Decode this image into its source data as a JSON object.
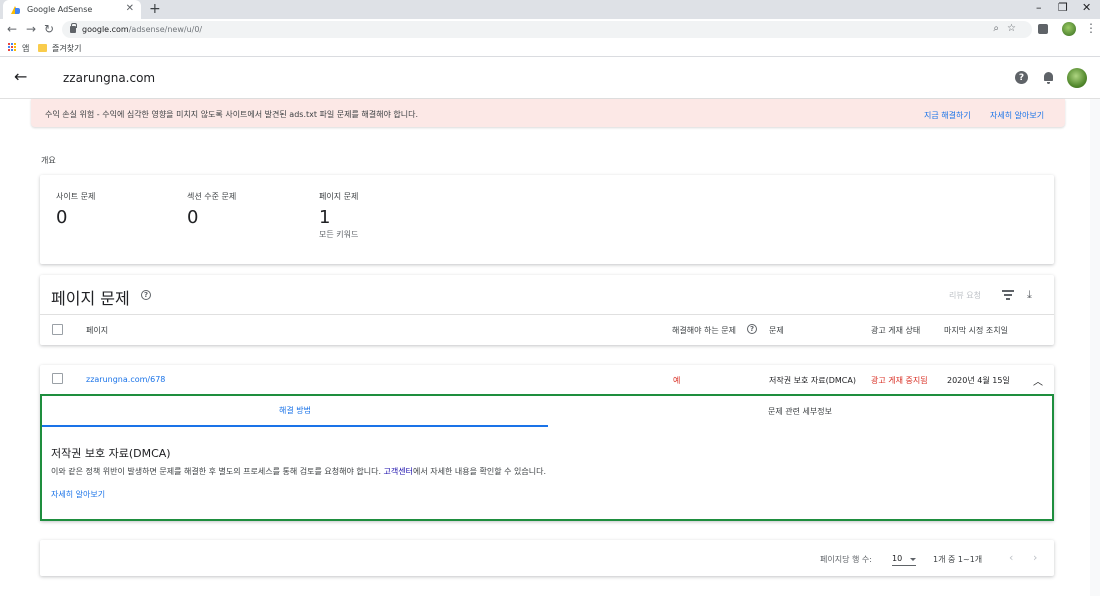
{
  "browser": {
    "tab_title": "Google AdSense",
    "tab_close": "✕",
    "new_tab": "+",
    "url_host": "google.com",
    "url_path": "/adsense/new/u/0/",
    "bookmarks": [
      {
        "label": "앱"
      },
      {
        "label": "즐겨찾기"
      }
    ],
    "window_controls": [
      "–",
      "❐",
      "✕"
    ]
  },
  "appbar": {
    "back": "←",
    "site": "zzarungna.com",
    "help": "?"
  },
  "alert": {
    "message": "수익 손실 위험 - 수익에 심각한 영향을 미치지 않도록 사이트에서 발견된 ads.txt 파일 문제를 해결해야 합니다.",
    "fix_now": "지금 해결하기",
    "learn_more": "자세히 알아보기",
    "color": "#fce8e6"
  },
  "overview": {
    "label": "개요",
    "stats": [
      {
        "label": "사이트 문제",
        "value": "0",
        "sub": ""
      },
      {
        "label": "섹션 수준 문제",
        "value": "0",
        "sub": ""
      },
      {
        "label": "페이지 문제",
        "value": "1",
        "sub": "모든 키워드"
      }
    ]
  },
  "issues": {
    "title": "페이지 문제",
    "review_request": "리뷰 요청",
    "columns": {
      "page": "페이지",
      "must_fix": "해결해야 하는 문제",
      "issue": "문제",
      "ad_status": "광고 게재 상태",
      "last_action": "마지막 시정 조치일"
    },
    "rows": [
      {
        "page": "zzarungna.com/678",
        "must_fix": "예",
        "issue": "저작권 보호 자료(DMCA)",
        "ad_status": "광고 게재 중지됨",
        "last_action": "2020년 4월 15일",
        "expanded": true
      }
    ]
  },
  "detail": {
    "tabs": [
      {
        "label": "해결 방법",
        "active": true
      },
      {
        "label": "문제 관련 세부정보",
        "active": false
      }
    ],
    "title": "저작권 보호 자료(DMCA)",
    "body_before": "이와 같은 정책 위반이 발생하면 문제를 해결한 후 별도의 프로세스를 통해 검토를 요청해야 합니다. ",
    "body_link": "고객센터",
    "body_after": "에서 자세한 내용을 확인할 수 있습니다.",
    "learn_more": "자세히 알아보기",
    "border_color": "#1e8e3e"
  },
  "pager": {
    "rows_per_page_label": "페이지당 행 수:",
    "rows_per_page": "10",
    "range": "1개 중 1~1개",
    "prev": "‹",
    "next": "›"
  },
  "colors": {
    "accent": "#1a73e8",
    "danger": "#d93025",
    "success_border": "#1e8e3e"
  }
}
